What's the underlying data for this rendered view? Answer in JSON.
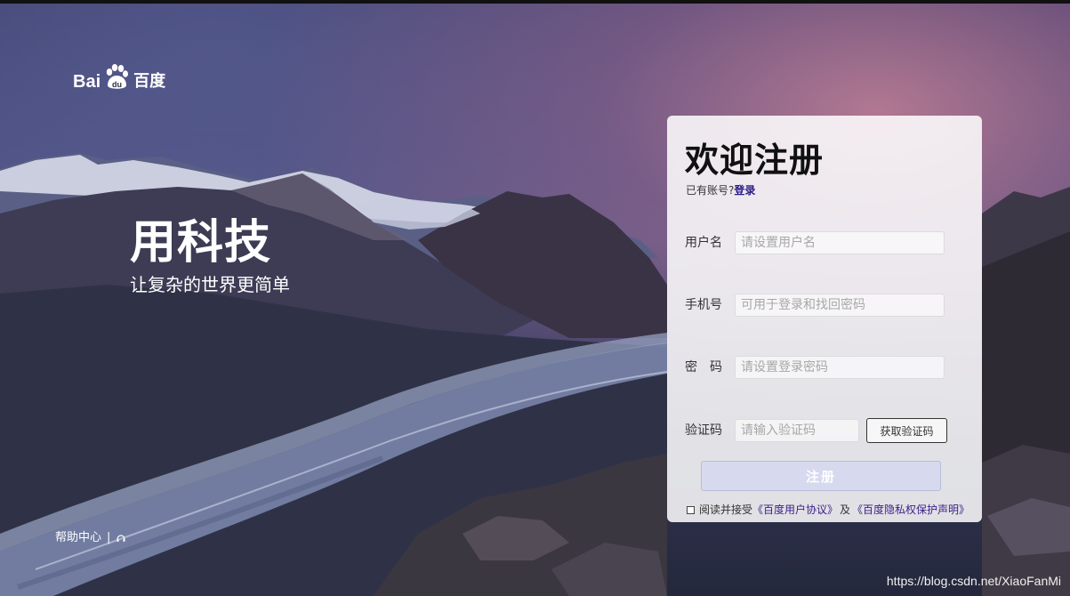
{
  "logo": {
    "latin_left": "Bai",
    "latin_right": "du",
    "chinese": "百度"
  },
  "slogan": {
    "title": "用科技",
    "subtitle": "让复杂的世界更简单"
  },
  "help": {
    "link": "帮助中心",
    "separator": "|",
    "icon": "headset-icon"
  },
  "watermark": "https://blog.csdn.net/XiaoFanMi",
  "register": {
    "title": "欢迎注册",
    "have_account": "已有账号?",
    "login_link": "登录",
    "fields": [
      {
        "label": "用户名",
        "placeholder": "请设置用户名",
        "value": ""
      },
      {
        "label": "手机号",
        "placeholder": "可用于登录和找回密码",
        "value": ""
      },
      {
        "label": "密　码",
        "placeholder": "请设置登录密码",
        "value": ""
      },
      {
        "label": "验证码",
        "placeholder": "请输入验证码",
        "value": ""
      }
    ],
    "get_code_button": "获取验证码",
    "submit_button": "注册",
    "agree": {
      "prefix": "阅读并接受",
      "user_agreement": "《百度用户协议》",
      "and": "及",
      "privacy": "《百度隐私权保护声明》"
    }
  },
  "colors": {
    "panel_bg": "#ffffff",
    "link": "#3a1d8a",
    "submit_bg": "#d7d9ef"
  }
}
